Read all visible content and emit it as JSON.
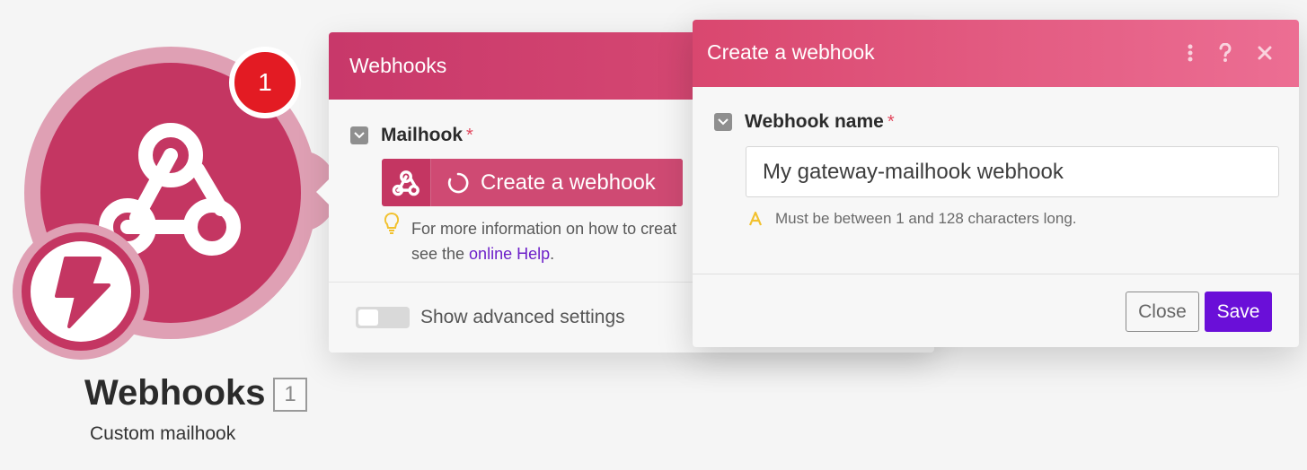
{
  "module": {
    "title": "Webhooks",
    "subtitle": "Custom mailhook",
    "id_badge": "1",
    "count_badge": "1",
    "icon": "webhook-icon",
    "trigger_icon": "lightning-icon",
    "colors": {
      "brand": "#c43662",
      "ring": "#dfa0b4",
      "badge": "#e31b23"
    }
  },
  "panel": {
    "title": "Webhooks",
    "field_label": "Mailhook",
    "required_mark": "*",
    "create_button_label": "Create a webhook",
    "help_text_line1": "For more information on how to creat",
    "help_text_prefix": "see the ",
    "help_link": "online Help",
    "help_text_suffix": ".",
    "advanced_toggle_label": "Show advanced settings"
  },
  "dialog": {
    "title": "Create a webhook",
    "field_label": "Webhook name",
    "required_mark": "*",
    "input_value": "My gateway-mailhook webhook",
    "hint": "Must be between 1 and 128 characters long.",
    "close_label": "Close",
    "save_label": "Save",
    "colors": {
      "accent": "#6a0fd8",
      "header": "#d9476f"
    }
  }
}
